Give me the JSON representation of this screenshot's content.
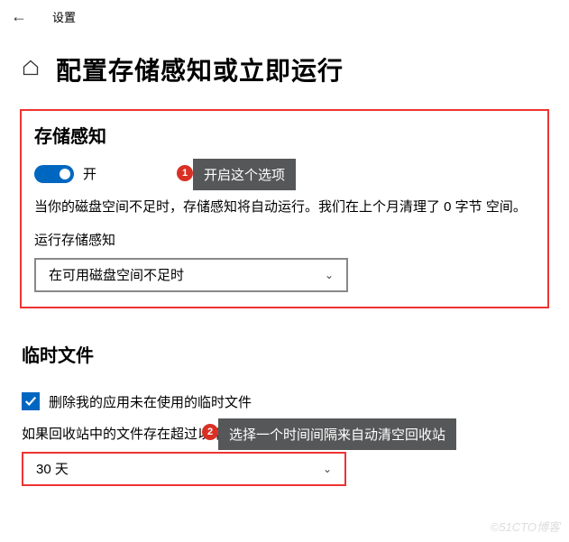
{
  "header": {
    "settings_label": "设置"
  },
  "page": {
    "title": "配置存储感知或立即运行"
  },
  "storage_sense": {
    "heading": "存储感知",
    "toggle_label": "开",
    "callout_badge": "1",
    "callout_text": "开启这个选项",
    "description": "当你的磁盘空间不足时，存储感知将自动运行。我们在上个月清理了 0 字节 空间。",
    "run_label": "运行存储感知",
    "dropdown_value": "在可用磁盘空间不足时"
  },
  "temp_files": {
    "heading": "临时文件",
    "checkbox_label": "删除我的应用未在使用的临时文件",
    "line2": "如果回收站中的文件存在超过以下时长，请将其删除",
    "callout_badge": "2",
    "callout_text": "选择一个时间间隔来自动清空回收站",
    "dropdown_value": "30 天"
  },
  "watermark": "©51CTO博客"
}
